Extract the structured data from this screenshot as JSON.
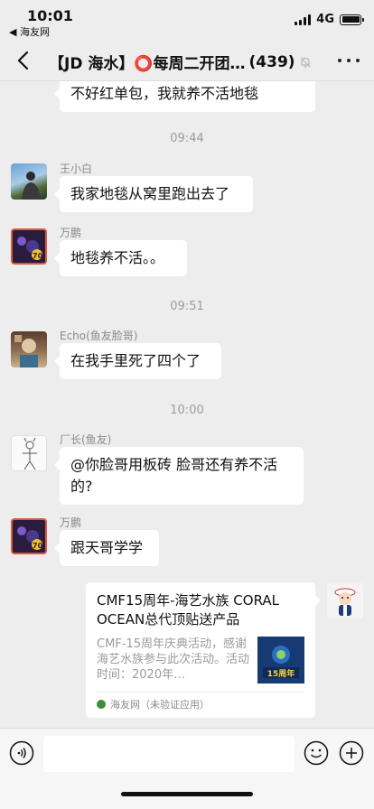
{
  "status_bar": {
    "time": "10:01",
    "back_app": "◀ 海友网",
    "network": "4G",
    "signal_bars": 4,
    "battery_level": 1.0
  },
  "nav": {
    "title": "【JD 海水】⭕每周二开团…",
    "member_count": "(439)"
  },
  "messages": {
    "m0": {
      "text": "不好红单包，我就养不活地毯"
    },
    "t1": "09:44",
    "m1": {
      "sender": "王小白",
      "text": "我家地毯从窝里跑出去了"
    },
    "m2": {
      "sender": "万鹏",
      "text": "地毯养不活。。"
    },
    "t2": "09:51",
    "m3": {
      "sender": "Echo(鱼友脸哥)",
      "text": "在我手里死了四个了"
    },
    "t3": "10:00",
    "m4": {
      "sender": "厂长(鱼友)",
      "line1": "@你脸哥用板砖 脸哥还有养不活",
      "line2": "的?"
    },
    "m5": {
      "sender": "万鹏",
      "text": "跟天哥学学"
    }
  },
  "card": {
    "title": "CMF15周年-海艺水族 CORAL OCEAN总代顶贴送产品",
    "desc": "CMF-15周年庆典活动，感谢海艺水族参与此次活动。活动时间：2020年…",
    "thumb_text": "15周年",
    "source": "海友网（未验证应用）"
  },
  "colors": {
    "background": "#ededed",
    "bubble": "#ffffff",
    "meta_text": "#9b9b9b"
  },
  "icons": {
    "back": "chevron-left-icon",
    "more": "more-dots-icon",
    "mute": "bell-off-icon",
    "voice": "voice-icon",
    "emoji": "emoji-icon",
    "plus": "plus-circle-icon"
  }
}
